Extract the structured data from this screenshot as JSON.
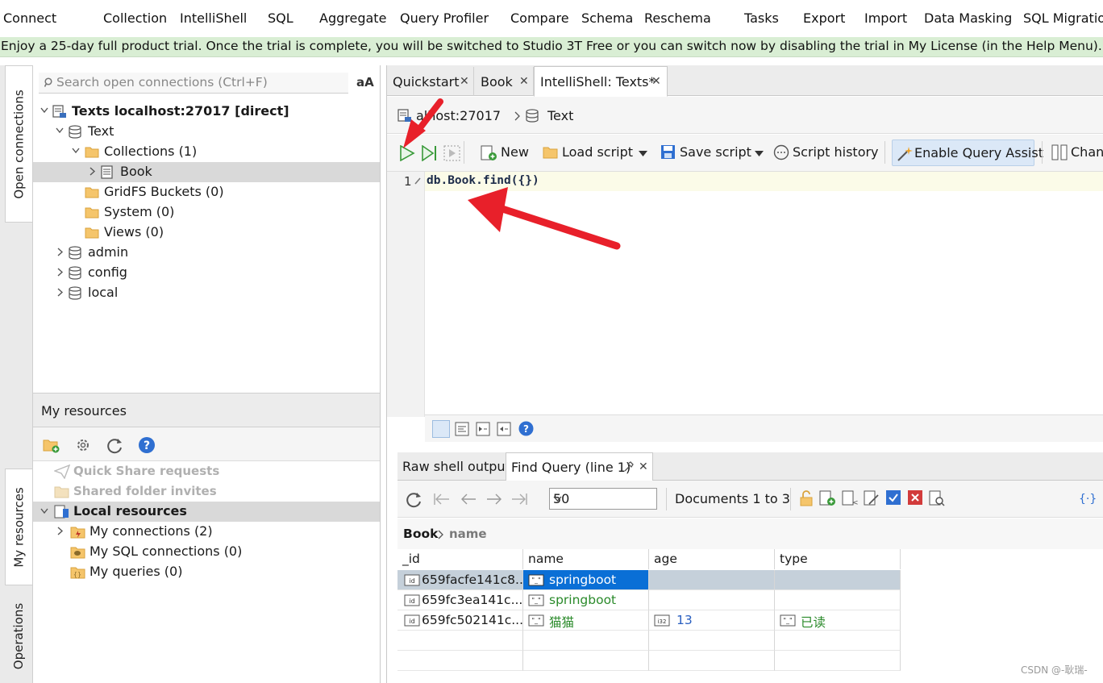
{
  "menu": [
    "Connect",
    "Collection",
    "IntelliShell",
    "SQL",
    "Aggregate",
    "Query Profiler",
    "Compare",
    "Schema",
    "Reschema",
    "Tasks",
    "Export",
    "Import",
    "Data Masking",
    "SQL Migration"
  ],
  "trial_banner": "Enjoy a 25-day full product trial. Once the trial is complete, you will be switched to Studio 3T Free or you can switch now by disabling the trial in My License (in the Help Menu).",
  "side_tabs": {
    "open": "Open connections",
    "myres": "My resources",
    "ops": "Operations"
  },
  "search": {
    "placeholder": "Search open connections (Ctrl+F)",
    "case_label": "aA"
  },
  "tree": {
    "connection": "Texts localhost:27017 [direct]",
    "db": "Text",
    "collections": "Collections (1)",
    "book": "Book",
    "gridfs": "GridFS Buckets (0)",
    "system": "System (0)",
    "views": "Views (0)",
    "admin": "admin",
    "config": "config",
    "local": "local"
  },
  "my_resources": {
    "header": "My resources",
    "quick_share": "Quick Share requests",
    "shared_folder": "Shared folder invites",
    "local_resources": "Local resources",
    "my_connections": "My connections (2)",
    "my_sql": "My SQL connections (0)",
    "my_queries": "My queries (0)"
  },
  "doc_tabs": [
    "Quickstart",
    "Book",
    "IntelliShell: Texts*"
  ],
  "breadcrumb": {
    "host": "alhost:27017",
    "db": "Text"
  },
  "shell_toolbar": {
    "new": "New",
    "load": "Load script",
    "save": "Save script",
    "history": "Script history",
    "query_assist": "Enable Query Assist",
    "change": "Chang"
  },
  "editor": {
    "line_number": "1",
    "code": "db.Book.find({})"
  },
  "result_tabs": {
    "raw": "Raw shell output",
    "find": "Find Query (line 1)"
  },
  "results": {
    "page_size": "50",
    "doc_count": "Documents 1 to 3",
    "path_root": "Book",
    "path_field": "name",
    "columns": [
      "_id",
      "name",
      "age",
      "type"
    ],
    "rows": [
      {
        "id": "659facfe141c8...",
        "name": "springboot",
        "age": "",
        "type": ""
      },
      {
        "id": "659fc3ea141c...",
        "name": "springboot",
        "age": "",
        "type": ""
      },
      {
        "id": "659fc502141c...",
        "name": "猫猫",
        "age": "13",
        "type": "已读"
      }
    ]
  },
  "watermark": "CSDN @-耿瑞-",
  "colors": {
    "accent_green": "#2a8a2a",
    "selection_blue": "#0a6fd6",
    "arrow_red": "#e8202a",
    "trial_bg": "#d9eed4"
  }
}
